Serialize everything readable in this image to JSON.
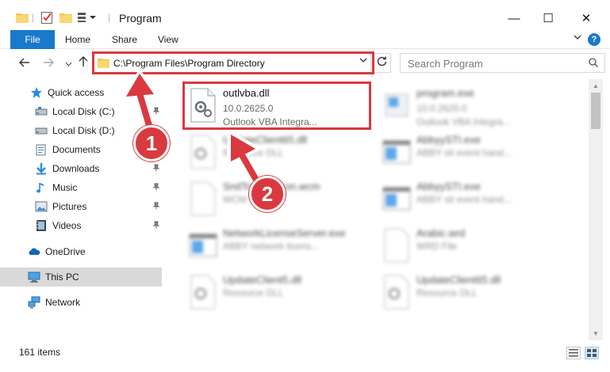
{
  "window": {
    "title": "Program",
    "minimize": "—",
    "maximize": "☐",
    "close": "✕"
  },
  "ribbon": {
    "tabs": [
      "File",
      "Home",
      "Share",
      "View"
    ],
    "help": "?"
  },
  "address": {
    "path": "C:\\Program Files\\Program Directory",
    "search_placeholder": "Search Program"
  },
  "nav": {
    "items": [
      {
        "label": "Quick access",
        "icon": "star-icon"
      },
      {
        "label": "Local Disk (C:)",
        "icon": "drive-icon",
        "pinned": true
      },
      {
        "label": "Local Disk (D:)",
        "icon": "drive-icon"
      },
      {
        "label": "Documents",
        "icon": "documents-icon",
        "pinned": true
      },
      {
        "label": "Downloads",
        "icon": "download-icon",
        "pinned": true
      },
      {
        "label": "Music",
        "icon": "music-icon",
        "pinned": true
      },
      {
        "label": "Pictures",
        "icon": "pictures-icon",
        "pinned": true
      },
      {
        "label": "Videos",
        "icon": "videos-icon",
        "pinned": true
      },
      {
        "label": "OneDrive",
        "icon": "cloud-icon"
      },
      {
        "label": "This PC",
        "icon": "computer-icon",
        "selected": true
      },
      {
        "label": "Network",
        "icon": "network-icon"
      }
    ]
  },
  "files": [
    {
      "name": "outlvba.dll",
      "version": "10.0.2625.0",
      "desc": "Outlook VBA Integra...",
      "type": "dll"
    },
    {
      "name": "program.exe",
      "version": "10.0.2625.0",
      "desc": "Outlook VBA Integra...",
      "type": "exe"
    },
    {
      "name": "UpdateClient65.dll",
      "version": "",
      "desc": "Resource DLL",
      "type": "dll"
    },
    {
      "name": "AbbyySTI.exe",
      "version": "",
      "desc": "ABBY sti event hand...",
      "type": "window"
    },
    {
      "name": "SndToWordIcon.wcm",
      "version": "",
      "desc": "WCM File",
      "type": "doc"
    },
    {
      "name": "AbbyySTI.exe",
      "version": "",
      "desc": "ABBY sti event hand...",
      "type": "window"
    },
    {
      "name": "NetworkLicenseServer.exe",
      "version": "",
      "desc": "ABBY network licens...",
      "type": "window"
    },
    {
      "name": "Arabic.wrd",
      "version": "",
      "desc": "WRD File",
      "type": "doc"
    },
    {
      "name": "UpdateClient5.dll",
      "version": "",
      "desc": "Resource DLL",
      "type": "dll"
    },
    {
      "name": "UpdateClient65.dll",
      "version": "",
      "desc": "Resource DLL",
      "type": "dll"
    }
  ],
  "status": {
    "count": "161 items"
  },
  "annotations": {
    "step1": "1",
    "step2": "2"
  },
  "colors": {
    "accent": "#1979ca",
    "annotation": "#d9393f",
    "selected": "#d9d9d9"
  }
}
